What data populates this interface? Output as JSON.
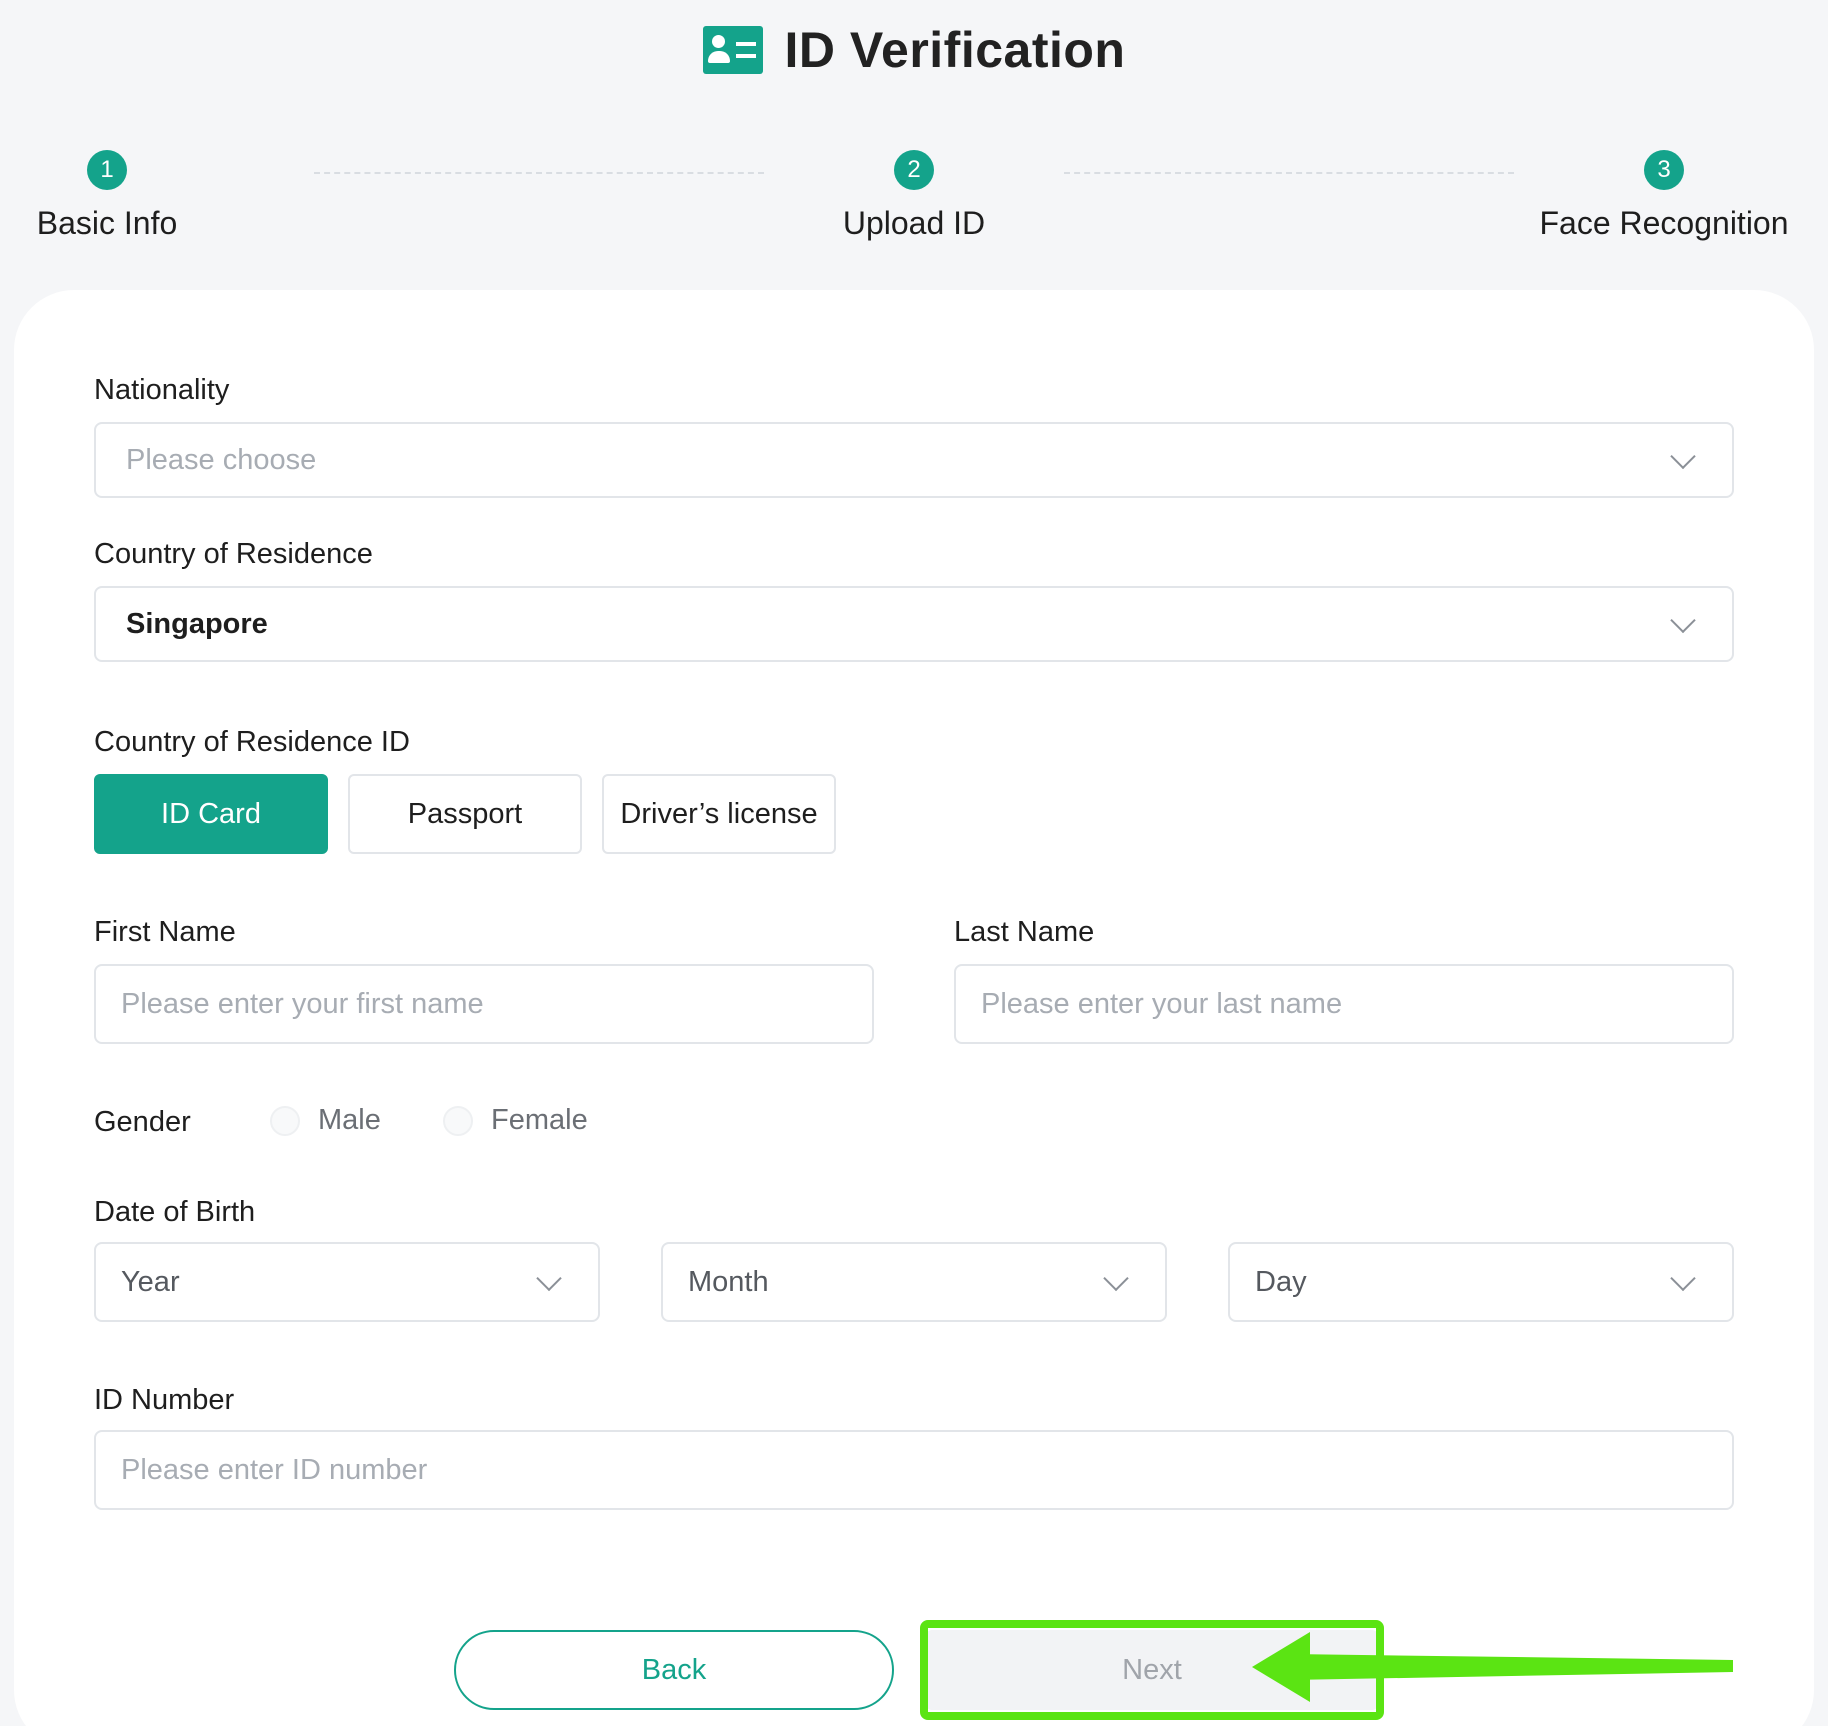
{
  "header": {
    "title": "ID Verification",
    "icon": "id-card-icon"
  },
  "steps": [
    {
      "num": "1",
      "label": "Basic Info"
    },
    {
      "num": "2",
      "label": "Upload ID"
    },
    {
      "num": "3",
      "label": "Face Recognition"
    }
  ],
  "form": {
    "nationality": {
      "label": "Nationality",
      "placeholder": "Please choose"
    },
    "residence": {
      "label": "Country of Residence",
      "value": "Singapore"
    },
    "residence_id": {
      "label": "Country of Residence ID",
      "options": [
        "ID Card",
        "Passport",
        "Driver’s license"
      ],
      "selected": "ID Card"
    },
    "first_name": {
      "label": "First Name",
      "placeholder": "Please enter your first name"
    },
    "last_name": {
      "label": "Last Name",
      "placeholder": "Please enter your last name"
    },
    "gender": {
      "label": "Gender",
      "options": [
        "Male",
        "Female"
      ]
    },
    "dob": {
      "label": "Date of Birth",
      "year": "Year",
      "month": "Month",
      "day": "Day"
    },
    "id_number": {
      "label": "ID Number",
      "placeholder": "Please enter ID number"
    }
  },
  "actions": {
    "back": "Back",
    "next": "Next"
  },
  "colors": {
    "accent": "#14a38b",
    "annotation": "#5be413"
  }
}
